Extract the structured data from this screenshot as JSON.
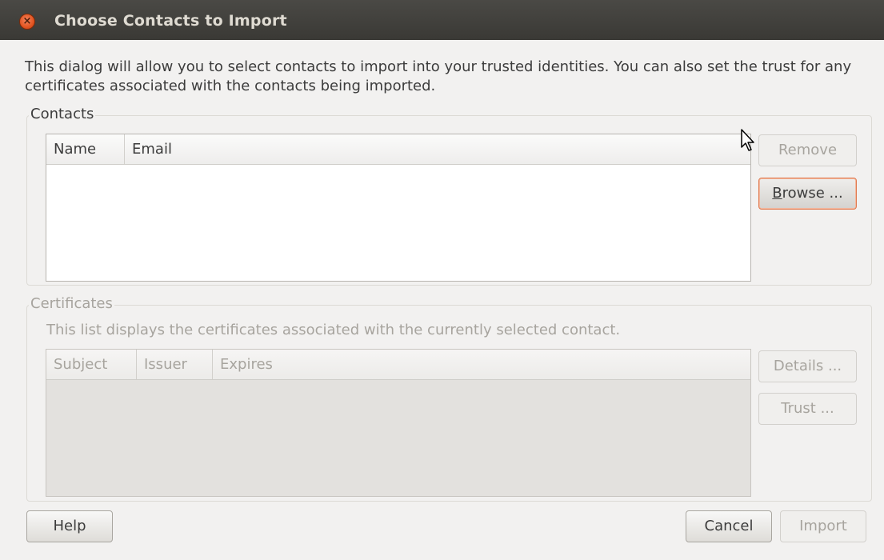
{
  "window": {
    "title": "Choose Contacts to Import",
    "close_glyph": "×"
  },
  "intro_text": "This dialog will allow you to select contacts to import into your trusted identities. You can also set the trust for any certificates associated with the contacts being imported.",
  "contacts": {
    "label": "Contacts",
    "columns": [
      "Name",
      "Email"
    ],
    "rows": [],
    "buttons": {
      "remove": "Remove",
      "browse_prefix": "B",
      "browse_rest": "rowse ..."
    }
  },
  "certificates": {
    "label": "Certificates",
    "description": "This list displays the certificates associated with the currently selected contact.",
    "columns": [
      "Subject",
      "Issuer",
      "Expires"
    ],
    "rows": [],
    "buttons": {
      "details": "Details ...",
      "trust": "Trust ..."
    }
  },
  "footer": {
    "help": "Help",
    "cancel": "Cancel",
    "import": "Import"
  },
  "colors": {
    "titlebar": "#3c3b37",
    "close_button": "#e25421",
    "focus_ring": "#e07a4f",
    "disabled_text": "#a7a49e"
  },
  "icons": {
    "close": "close-icon",
    "cursor": "mouse-pointer-icon"
  }
}
